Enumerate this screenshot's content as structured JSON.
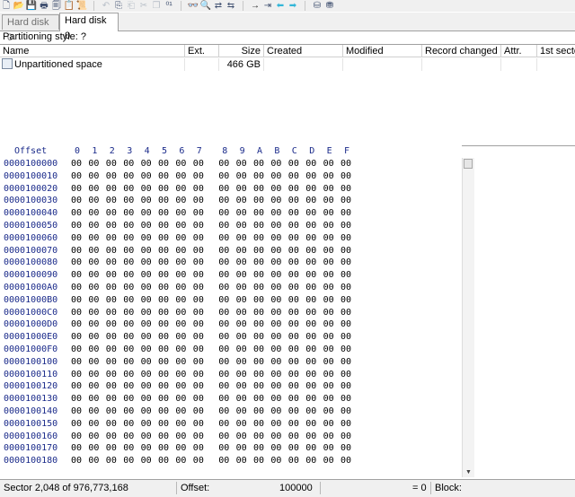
{
  "toolbar": {
    "icons": [
      {
        "name": "new-file-icon",
        "glyph": "🗋",
        "tone": ""
      },
      {
        "name": "open-file-icon",
        "glyph": "📂",
        "tone": ""
      },
      {
        "name": "save-icon",
        "glyph": "💾",
        "tone": "dim"
      },
      {
        "name": "print-icon",
        "glyph": "🖶",
        "tone": ""
      },
      {
        "name": "properties-icon",
        "glyph": "🗐",
        "tone": ""
      },
      {
        "name": "clipboard-icon",
        "glyph": "📋",
        "tone": ""
      },
      {
        "name": "script-icon",
        "glyph": "📜",
        "tone": ""
      },
      {
        "sep": true
      },
      {
        "name": "undo-icon",
        "glyph": "↶",
        "tone": "dim"
      },
      {
        "name": "copy-icon",
        "glyph": "⎘",
        "tone": ""
      },
      {
        "name": "paste-icon",
        "glyph": "⎗",
        "tone": "dim"
      },
      {
        "name": "cut-icon",
        "glyph": "✂",
        "tone": "dim"
      },
      {
        "name": "clone-icon",
        "glyph": "❐",
        "tone": "dim"
      },
      {
        "name": "binary-icon",
        "glyph": "⁰¹",
        "tone": ""
      },
      {
        "sep": true
      },
      {
        "name": "find-icon",
        "glyph": "👓",
        "tone": "dark"
      },
      {
        "name": "find-hex-icon",
        "glyph": "🔍",
        "tone": ""
      },
      {
        "name": "replace-icon",
        "glyph": "⇄",
        "tone": ""
      },
      {
        "name": "replace-hex-icon",
        "glyph": "⇆",
        "tone": ""
      },
      {
        "sep": true
      },
      {
        "name": "goto-offset-icon",
        "glyph": "→",
        "tone": "dark"
      },
      {
        "name": "goto-sector-icon",
        "glyph": "⇥",
        "tone": ""
      },
      {
        "name": "back-icon",
        "glyph": "⬅",
        "tone": "cyan"
      },
      {
        "name": "forward-icon",
        "glyph": "➡",
        "tone": "cyan"
      },
      {
        "sep": true
      },
      {
        "name": "disk-icon",
        "glyph": "⛁",
        "tone": ""
      },
      {
        "name": "disk-tools-icon",
        "glyph": "⛃",
        "tone": ""
      }
    ]
  },
  "tabs": [
    {
      "label": "Hard disk 0",
      "active": false
    },
    {
      "label": "Hard disk 0",
      "active": true
    }
  ],
  "partitioning_style": "Partitioning style: ?",
  "directory": {
    "columns": [
      "Name",
      "Ext.",
      "Size",
      "Created",
      "Modified",
      "Record changed",
      "Attr.",
      "1st secto"
    ],
    "rows": [
      {
        "name": "Unpartitioned space",
        "ext": "",
        "size": "466 GB",
        "created": "",
        "modified": "",
        "record_changed": "",
        "attr": "",
        "first_sector": ""
      }
    ]
  },
  "hex": {
    "header_label": "Offset",
    "header_cols": [
      "0",
      "1",
      "2",
      "3",
      "4",
      "5",
      "6",
      "7",
      "8",
      "9",
      "A",
      "B",
      "C",
      "D",
      "E",
      "F"
    ],
    "offsets": [
      "0000100000",
      "0000100010",
      "0000100020",
      "0000100030",
      "0000100040",
      "0000100050",
      "0000100060",
      "0000100070",
      "0000100080",
      "0000100090",
      "00001000A0",
      "00001000B0",
      "00001000C0",
      "00001000D0",
      "00001000E0",
      "00001000F0",
      "0000100100",
      "0000100110",
      "0000100120",
      "0000100130",
      "0000100140",
      "0000100150",
      "0000100160",
      "0000100170",
      "0000100180"
    ],
    "byte_value": "00"
  },
  "status": {
    "sector": "Sector 2,048 of 976,773,168",
    "offset_label": "Offset:",
    "offset_value": "100000",
    "equals": "= 0",
    "block_label": "Block:"
  }
}
